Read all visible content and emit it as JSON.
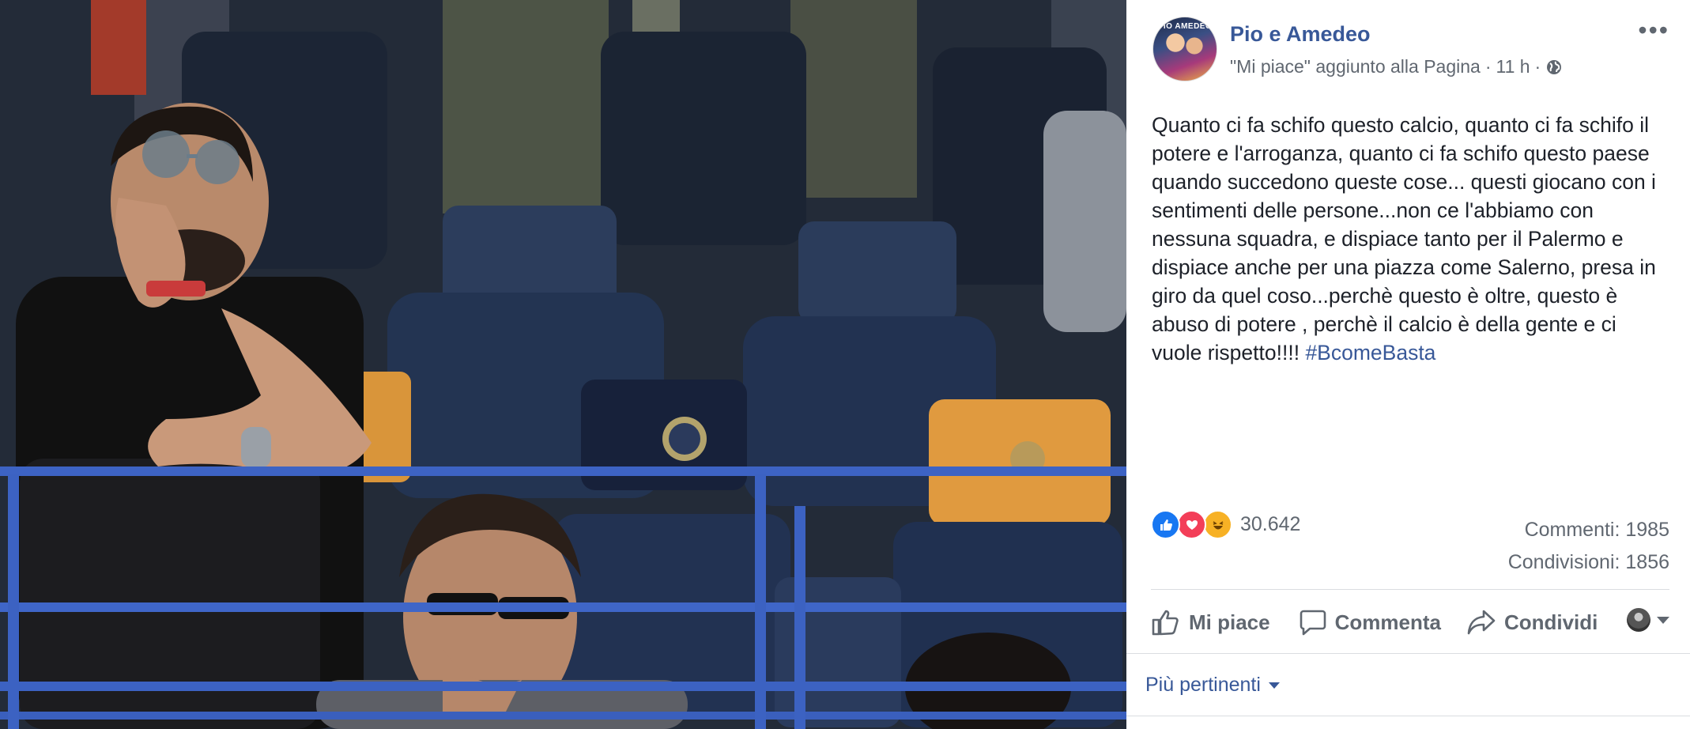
{
  "post": {
    "page_name": "Pio e Amedeo",
    "avatar_text": "PIO AMEDEO",
    "meta_text": "\"Mi piace\" aggiunto alla Pagina",
    "time": "11 h",
    "text_main": "Quanto ci fa schifo questo calcio, quanto ci fa schifo il potere e l'arroganza, quanto ci fa schifo questo paese quando succedono queste cose... questi giocano con i sentimenti delle persone...non ce l'abbiamo con nessuna squadra, e dispiace tanto per il Palermo e dispiace anche per una piazza come Salerno, presa in giro da quel coso...perchè questo è oltre, questo è abuso di potere , perchè il calcio è della gente e ci vuole rispetto!!!! ",
    "hashtag": "#BcomeBasta"
  },
  "stats": {
    "reactions_count": "30.642",
    "comments": "Commenti: 1985",
    "shares": "Condivisioni: 1856"
  },
  "actions": {
    "like": "Mi piace",
    "comment": "Commenta",
    "share": "Condividi"
  },
  "comments_sort": "Più pertinenti",
  "icons": [
    "globe-icon",
    "more-options-icon",
    "like-reaction-icon",
    "love-reaction-icon",
    "haha-reaction-icon",
    "thumbs-up-icon",
    "comment-icon",
    "share-icon",
    "chevron-down-icon"
  ],
  "colors": {
    "link": "#385898",
    "secondary_text": "#606770",
    "like_blue": "#1877f2",
    "love_red": "#f33e58",
    "haha_yellow": "#f7b125"
  }
}
